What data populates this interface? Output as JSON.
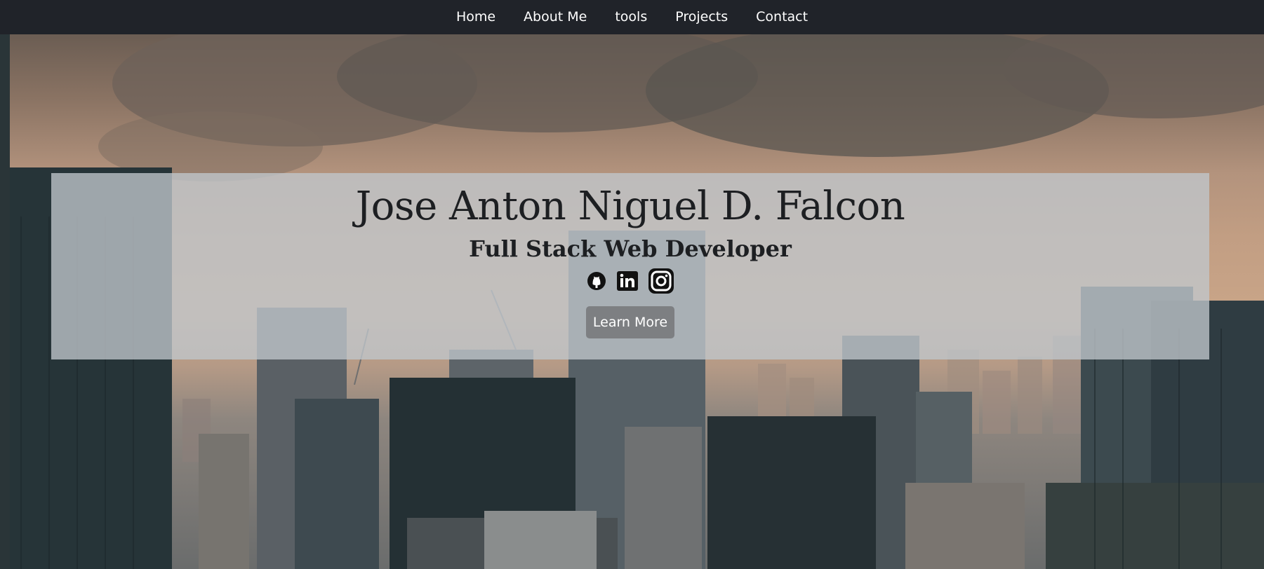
{
  "nav": {
    "items": [
      {
        "label": "Home"
      },
      {
        "label": "About Me"
      },
      {
        "label": "tools"
      },
      {
        "label": "Projects"
      },
      {
        "label": "Contact"
      }
    ]
  },
  "hero": {
    "name": "Jose Anton Niguel D. Falcon",
    "role": "Full Stack Web Developer",
    "socials": [
      {
        "icon": "github-icon"
      },
      {
        "icon": "linkedin-icon"
      },
      {
        "icon": "instagram-icon"
      }
    ],
    "cta_label": "Learn More",
    "background": "city-skyline-photo"
  },
  "colors": {
    "navbar": "#202329",
    "card": "#c0c6cc",
    "button": "#7d7f82",
    "text_dark": "#1d1f22"
  }
}
